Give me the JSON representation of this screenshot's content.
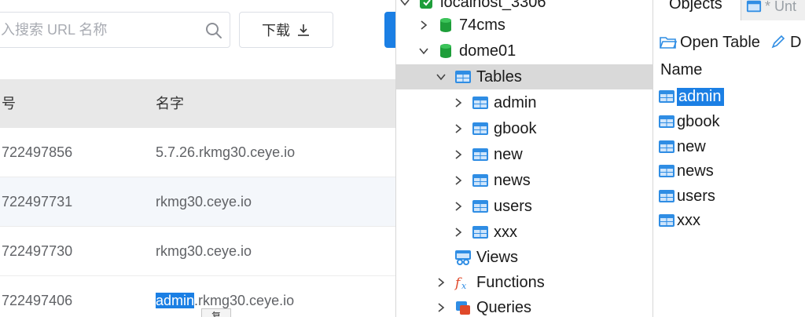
{
  "web_panel": {
    "search_placeholder": "入搜索 URL 名称",
    "download_label": "下载",
    "columns": {
      "id": "号",
      "name": "名字"
    },
    "rows": [
      {
        "id": "722497856",
        "name": "5.7.26.rkmg30.ceye.io"
      },
      {
        "id": "722497731",
        "name": "rkmg30.ceye.io"
      },
      {
        "id": "722497730",
        "name": "rkmg30.ceye.io"
      },
      {
        "id": "722497406",
        "name_highlight": "admin",
        "name_rest": ".rkmg30.ceye.io"
      }
    ],
    "tooltip_fragment": "复"
  },
  "tree": {
    "connection": "localhost_3306",
    "databases": [
      "74cms",
      "dome01"
    ],
    "tables_label": "Tables",
    "tables": [
      "admin",
      "gbook",
      "new",
      "news",
      "users",
      "xxx"
    ],
    "views_label": "Views",
    "functions_label": "Functions",
    "queries_label": "Queries"
  },
  "objects_panel": {
    "tab_objects": "Objects",
    "tab_untitled": "* Unt",
    "toolbar_open_table": "Open Table",
    "toolbar_design_fragment": "D",
    "column_header": "Name",
    "items": [
      "admin",
      "gbook",
      "new",
      "news",
      "users",
      "xxx"
    ]
  },
  "colors": {
    "selection_blue": "#1b7fe4",
    "table_icon_blue": "#2f8de4",
    "database_green": "#1e9e3a",
    "tree_selected_bg": "#d9d9d9"
  },
  "icons": [
    "search-icon",
    "download-icon",
    "chevron-right-icon",
    "chevron-down-icon",
    "database-icon",
    "table-icon",
    "views-icon",
    "function-icon",
    "query-icon",
    "folder-open-icon",
    "pencil-icon",
    "connection-icon"
  ]
}
